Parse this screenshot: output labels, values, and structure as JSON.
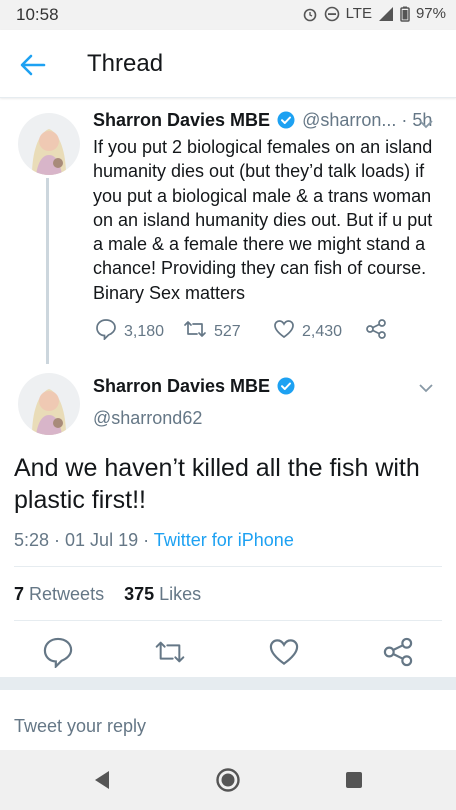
{
  "status_bar": {
    "time": "10:58",
    "network": "LTE",
    "battery": "97%",
    "icons": [
      "alarm-icon",
      "do-not-disturb-icon",
      "signal-icon",
      "battery-icon"
    ]
  },
  "app_bar": {
    "title": "Thread",
    "back_icon": "arrow-left-icon"
  },
  "colors": {
    "accent": "#1da1f2",
    "text": "#14171a",
    "muted": "#657786",
    "divider": "#e6ecf0"
  },
  "parent_tweet": {
    "name": "Sharron Davies MBE",
    "handle": "@sharron...",
    "time": "· 5h",
    "text": "If you put 2 biological females on an island humanity dies out (but they’d talk loads) if you put a biological male & a trans woman on an island humanity dies out. But if u put a male & a female there we might stand a chance! Providing they can fish of course. Binary Sex matters",
    "replies": "3,180",
    "retweets": "527",
    "likes": "2,430"
  },
  "main_tweet": {
    "name": "Sharron Davies MBE",
    "handle": "@sharrond62",
    "text": "And we haven’t killed all the fish with plastic first!!",
    "datetime": "5:28 · 01 Jul 19 · ",
    "source": "Twitter for iPhone",
    "retweet_count": "7",
    "retweet_label": "Retweets",
    "like_count": "375",
    "like_label": "Likes"
  },
  "reply_bar": {
    "placeholder": "Tweet your reply"
  }
}
